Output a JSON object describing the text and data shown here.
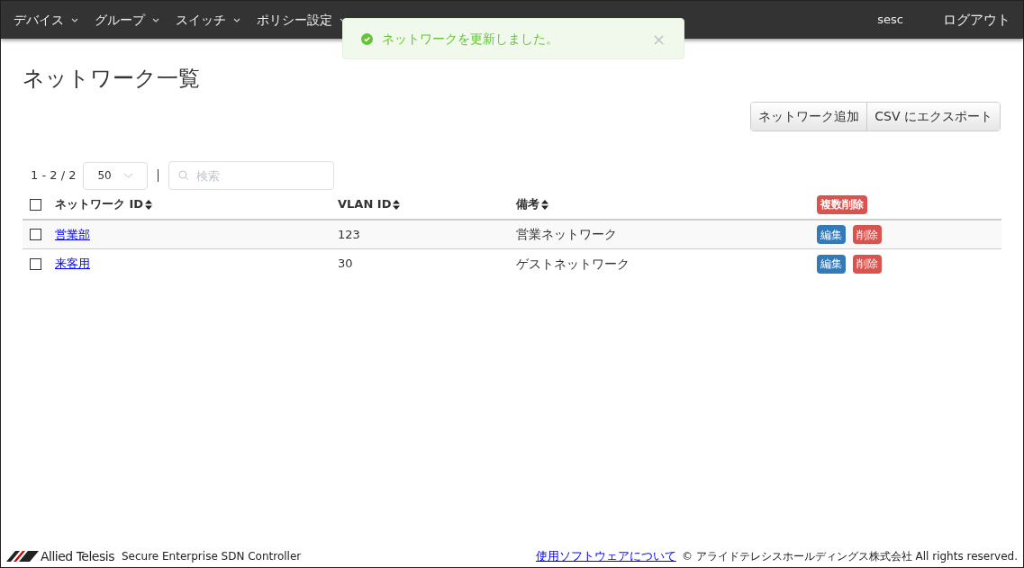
{
  "navbar": {
    "menus": [
      {
        "label": "デバイス"
      },
      {
        "label": "グループ"
      },
      {
        "label": "スイッチ"
      },
      {
        "label": "ポリシー設定"
      }
    ],
    "user": "sesc",
    "logout": "ログアウト"
  },
  "toast": {
    "message": "ネットワークを更新しました。",
    "close": "×"
  },
  "page_title": "ネットワーク一覧",
  "actions": [
    "ネットワーク追加",
    "CSV にエクスポート"
  ],
  "pager": {
    "range": "1 - 2 / 2",
    "page_size": "50"
  },
  "search": {
    "placeholder": "検索"
  },
  "table": {
    "columns": [
      "ネットワーク ID",
      "VLAN ID",
      "備考"
    ],
    "bulk_delete": "複数削除",
    "select_all": false,
    "rows": [
      {
        "name": "営業部",
        "vlan": "123",
        "note": "営業ネットワーク",
        "checked": false,
        "edit": "編集",
        "delete": "削除"
      },
      {
        "name": "来客用",
        "vlan": "30",
        "note": "ゲストネットワーク",
        "checked": false,
        "edit": "編集",
        "delete": "削除"
      }
    ]
  },
  "footer": {
    "brand": "Allied Telesis",
    "product": "Secure Enterprise SDN Controller",
    "link": "使用ソフトウェアについて",
    "copyright": "© アライドテレシスホールディングス株式会社 All rights reserved."
  }
}
